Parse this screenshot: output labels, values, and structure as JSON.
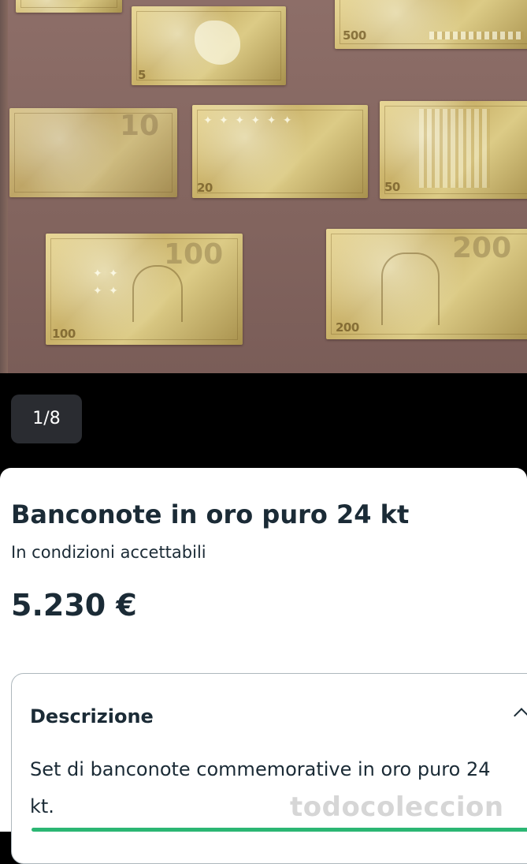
{
  "gallery": {
    "counter": "1/8",
    "notes": [
      {
        "id": "5",
        "value_label": "5"
      },
      {
        "id": "500",
        "value_label": "500"
      },
      {
        "id": "10",
        "value_label": "10"
      },
      {
        "id": "20",
        "value_label": "20"
      },
      {
        "id": "50",
        "value_label": "50"
      },
      {
        "id": "100",
        "value_label": "100"
      },
      {
        "id": "200",
        "value_label": "200"
      }
    ]
  },
  "listing": {
    "title": "Banconote in oro puro 24 kt",
    "condition": "In condizioni accettabili",
    "price": "5.230 €"
  },
  "description": {
    "heading": "Descrizione",
    "text": "Set di banconote commemorative in oro puro 24 kt.",
    "chevron_icon": "chevron-up-icon"
  },
  "watermark": "todocoleccion",
  "colors": {
    "text": "#1b2b36",
    "accent_green": "#2bb673",
    "counter_bg": "#2a2c31"
  }
}
